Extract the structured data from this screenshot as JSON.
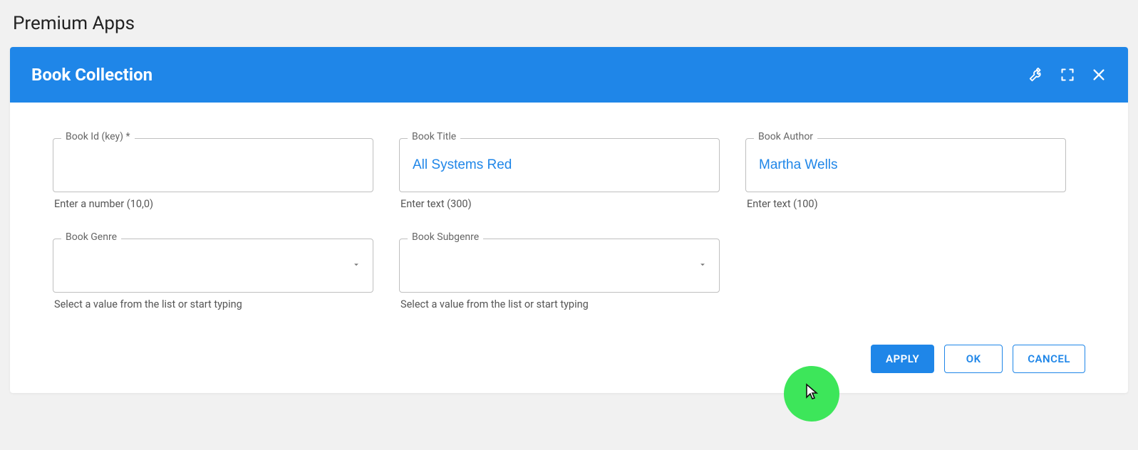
{
  "page": {
    "title": "Premium Apps"
  },
  "panel": {
    "title": "Book Collection"
  },
  "fields": {
    "book_id": {
      "label": "Book Id (key) *",
      "value": "",
      "hint": "Enter a number (10,0)"
    },
    "book_title": {
      "label": "Book Title",
      "value": "All Systems Red",
      "hint": "Enter text (300)"
    },
    "book_author": {
      "label": "Book Author",
      "value": "Martha Wells",
      "hint": "Enter text (100)"
    },
    "book_genre": {
      "label": "Book Genre",
      "value": "",
      "hint": "Select a value from the list or start typing"
    },
    "book_subgenre": {
      "label": "Book Subgenre",
      "value": "",
      "hint": "Select a value from the list or start typing"
    }
  },
  "buttons": {
    "apply": "APPLY",
    "ok": "OK",
    "cancel": "CANCEL"
  }
}
